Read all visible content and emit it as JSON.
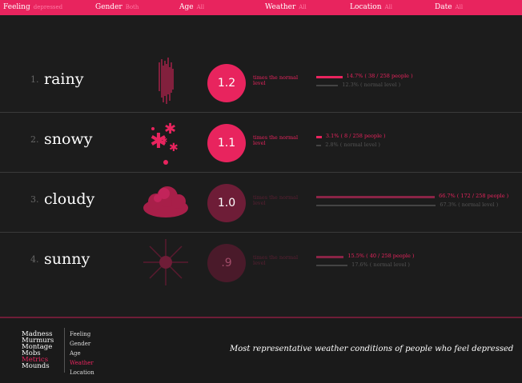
{
  "filters": [
    {
      "label": "Feeling",
      "value": "depressed"
    },
    {
      "label": "Gender",
      "value": "Both"
    },
    {
      "label": "Age",
      "value": "All"
    },
    {
      "label": "Weather",
      "value": "All"
    },
    {
      "label": "Location",
      "value": "All"
    },
    {
      "label": "Date",
      "value": "All"
    }
  ],
  "conditions": [
    {
      "rank": "1.",
      "name": "rainy",
      "ratio": "1.2",
      "times_label": "times the normal level",
      "bar_label": "14.7% ( 38 / 258 people )",
      "normal_label": "12.3% ( normal level )",
      "pct": 14.7,
      "normal_pct": 12.3
    },
    {
      "rank": "2.",
      "name": "snowy",
      "ratio": "1.1",
      "times_label": "times the normal level",
      "bar_label": "3.1% ( 8 / 258 people )",
      "normal_label": "2.8% ( normal level )",
      "pct": 3.1,
      "normal_pct": 2.8
    },
    {
      "rank": "3.",
      "name": "cloudy",
      "ratio": "1.0",
      "times_label": "times the normal level",
      "bar_label": "66.7% ( 172 / 258 people )",
      "normal_label": "67.3% ( normal level )",
      "pct": 66.7,
      "normal_pct": 67.3
    },
    {
      "rank": "4.",
      "name": "sunny",
      "ratio": ".9",
      "times_label": "times the normal level",
      "bar_label": "15.5% ( 40 / 258 people )",
      "normal_label": "17.6% ( normal level )",
      "pct": 15.5,
      "normal_pct": 17.6
    }
  ],
  "nav_left": [
    "Madness",
    "Murmurs",
    "Montage",
    "Mobs",
    "Metrics",
    "Mounds"
  ],
  "nav_left_active": "Metrics",
  "nav_right": [
    "Feeling",
    "Gender",
    "Age",
    "Weather",
    "Location"
  ],
  "nav_right_active": "Weather",
  "caption": "Most representative weather conditions of people who feel depressed",
  "colors": {
    "accent": "#e8245e",
    "background": "#1c1c1c"
  }
}
